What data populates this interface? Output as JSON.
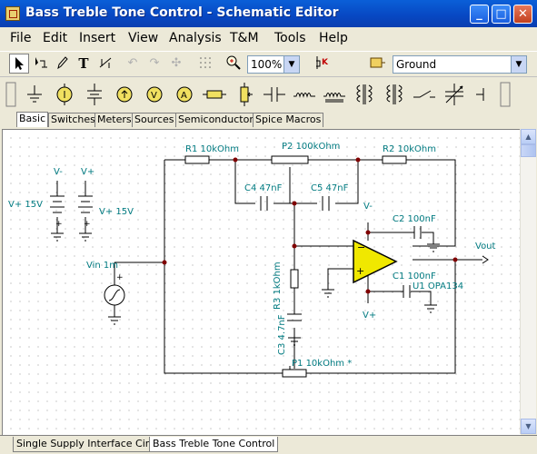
{
  "window": {
    "title": "Bass Treble Tone Control - Schematic Editor"
  },
  "menu": [
    "File",
    "Edit",
    "Insert",
    "View",
    "Analysis",
    "T&M",
    "Tools",
    "Help"
  ],
  "toolbar": {
    "zoom": "100%",
    "ground_select": "Ground"
  },
  "component_tabs": [
    "Basic",
    "Switches",
    "Meters",
    "Sources",
    "Semiconductors",
    "Spice Macros"
  ],
  "active_component_tab": "Basic",
  "schematic": {
    "labels": {
      "r1": "R1 10kOhm",
      "p2": "P2 100kOhm",
      "r2": "R2 10kOhm",
      "c4": "C4 47nF",
      "c5": "C5 47nF",
      "vminus_sym": "V-",
      "vplus_sym": "V+",
      "vplus15": "V+ 15V",
      "vplus15b": "V+ 15V",
      "c2": "C2 100nF",
      "vout": "Vout",
      "vin": "Vin 1m",
      "c1": "C1 100nF",
      "u1": "U1 OPA134",
      "r3": "R3 1kOhm",
      "c3": "C3 4.7nF",
      "p1": "P1 10kOhm *",
      "opamp_vminus": "V-",
      "opamp_vplus": "V+",
      "vplus_label_left": "V+",
      "vminus_label_left": "V-"
    }
  },
  "sheet_tabs": [
    "Single Supply Interface Circuit",
    "Bass Treble Tone Control"
  ],
  "active_sheet": "Bass Treble Tone Control"
}
